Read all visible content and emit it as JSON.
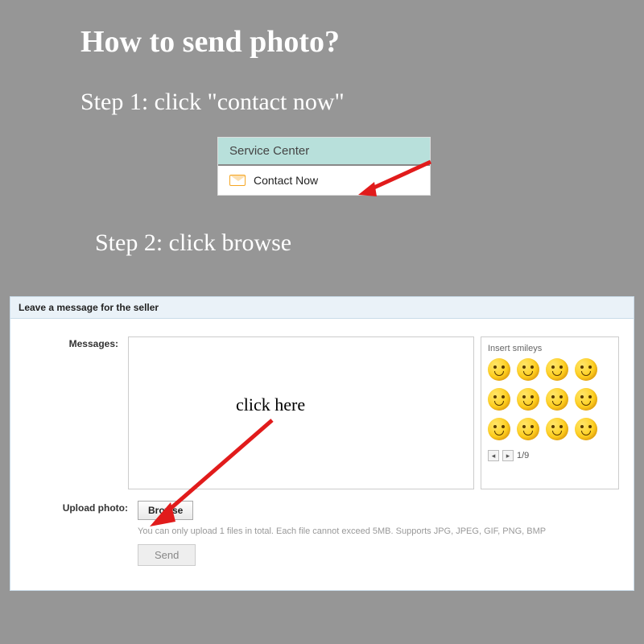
{
  "title": "How to send photo?",
  "step1_text": "Step 1: click \"contact now\"",
  "step2_text": "Step 2: click browse",
  "contact_card": {
    "header": "Service Center",
    "contact_now": "Contact Now"
  },
  "form": {
    "panel_title": "Leave a message for the seller",
    "labels": {
      "messages": "Messages:",
      "upload": "Upload photo:"
    },
    "smileys": {
      "title": "Insert smileys",
      "pager": "1/9",
      "count": 12
    },
    "browse_label": "Browse",
    "upload_hint": "You can only upload 1 files in total. Each file cannot exceed 5MB. Supports JPG, JPEG, GIF, PNG, BMP",
    "send_label": "Send"
  },
  "annotations": {
    "click_here": "click here"
  },
  "colors": {
    "arrow": "#e11b1b"
  }
}
